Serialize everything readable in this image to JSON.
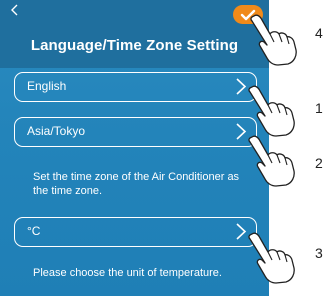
{
  "header": {
    "title": "Language/Time Zone Setting",
    "back_icon": "back-arrow-icon",
    "confirm_icon": "checkmark-icon"
  },
  "settings": [
    {
      "label": "English"
    },
    {
      "label": "Asia/Tokyo",
      "hint": "Set the time zone of the Air Conditioner as the time zone."
    },
    {
      "label": "°C",
      "hint": "Please choose the unit of temperature."
    }
  ],
  "callouts": [
    "4",
    "1",
    "2",
    "3"
  ],
  "colors": {
    "background": "#2384ba",
    "header": "#1f6f9e",
    "confirm": "#f08a1a"
  }
}
